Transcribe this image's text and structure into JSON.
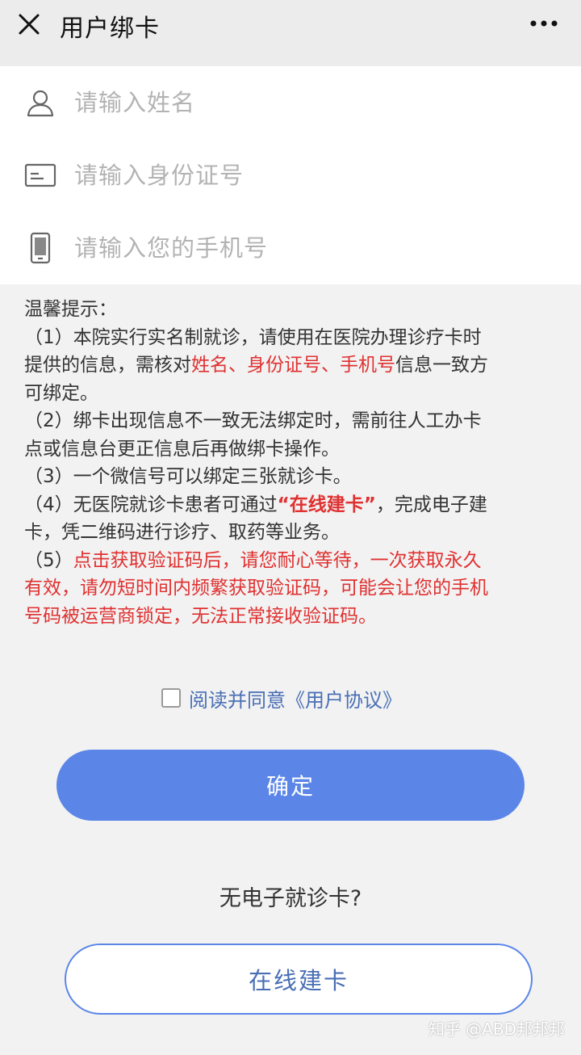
{
  "header": {
    "title": "用户绑卡"
  },
  "form": {
    "name_placeholder": "请输入姓名",
    "id_placeholder": "请输入身份证号",
    "phone_placeholder": "请输入您的手机号"
  },
  "tips": {
    "heading": "温馨提示：",
    "t1_a": "（1）本院实行实名制就诊，请使用在医院办理诊疗卡时",
    "t1_b": "提供的信息，需核对",
    "t1_red": "姓名、身份证号、手机号",
    "t1_c": "信息一致方",
    "t1_d": "可绑定。",
    "t2_a": "（2）绑卡出现信息不一致无法绑定时，需前往人工办卡",
    "t2_b": "点或信息台更正信息后再做绑卡操作。",
    "t3": "（3）一个微信号可以绑定三张就诊卡。",
    "t4_a": "（4）无医院就诊卡患者可通过",
    "t4_red": "“在线建卡”",
    "t4_b": "，完成电子建",
    "t4_c": "卡，凭二维码进行诊疗、取药等业务。",
    "t5_num": "（5）",
    "t5_a": "点击获取验证码后，请您耐心等待，一次获取永久",
    "t5_b": "有效，请勿短时间内频繁获取验证码，可能会让您的手机",
    "t5_c": "号码被运营商锁定，无法正常接收验证码。"
  },
  "agreement": {
    "label": "阅读并同意《用户协议》"
  },
  "buttons": {
    "confirm": "确定",
    "online": "在线建卡"
  },
  "no_card": "无电子就诊卡?",
  "watermark": "知乎 @ABD邦邦邦",
  "colors": {
    "primary": "#5b86e8",
    "warning_red": "#e03131",
    "link": "#4a6fb5"
  }
}
